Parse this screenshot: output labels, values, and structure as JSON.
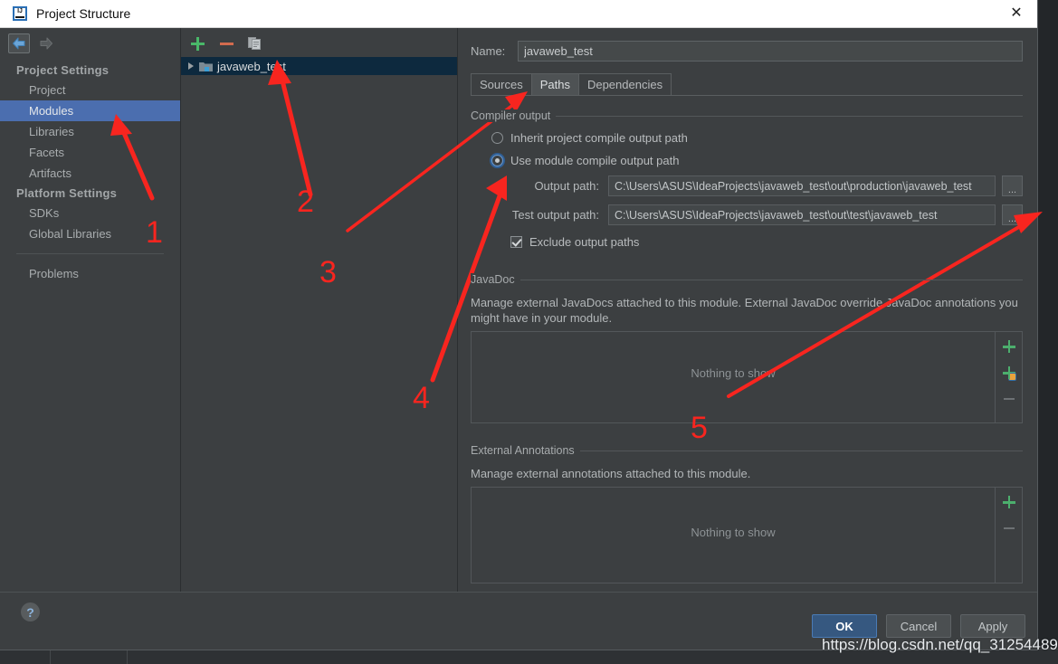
{
  "window": {
    "title": "Project Structure",
    "icon": "intellij-idea-icon",
    "close_label": "✕"
  },
  "sidebar": {
    "nav": {
      "back_icon": "arrow-left-icon",
      "forward_icon": "arrow-right-icon"
    },
    "groups": [
      {
        "label": "Project Settings",
        "items": [
          {
            "label": "Project",
            "selected": false
          },
          {
            "label": "Modules",
            "selected": true
          },
          {
            "label": "Libraries",
            "selected": false
          },
          {
            "label": "Facets",
            "selected": false
          },
          {
            "label": "Artifacts",
            "selected": false
          }
        ]
      },
      {
        "label": "Platform Settings",
        "items": [
          {
            "label": "SDKs",
            "selected": false
          },
          {
            "label": "Global Libraries",
            "selected": false
          }
        ]
      }
    ],
    "problems_label": "Problems"
  },
  "modules_panel": {
    "toolbar": {
      "add_label": "+",
      "remove_label": "−",
      "copy_icon": "copy-icon"
    },
    "items": [
      {
        "label": "javaweb_test",
        "selected": true,
        "expander": "triangle-right-icon",
        "icon": "module-folder-icon"
      }
    ]
  },
  "details": {
    "name_label": "Name:",
    "name_value": "javaweb_test",
    "tabs": [
      {
        "label": "Sources",
        "active": false
      },
      {
        "label": "Paths",
        "active": true
      },
      {
        "label": "Dependencies",
        "active": false
      }
    ],
    "compiler_output": {
      "legend": "Compiler output",
      "radio_inherit": "Inherit project compile output path",
      "radio_module": "Use module compile output path",
      "radio_selected": "module",
      "output_path_label": "Output path:",
      "output_path_value": "C:\\Users\\ASUS\\IdeaProjects\\javaweb_test\\out\\production\\javaweb_test",
      "test_output_path_label": "Test output path:",
      "test_output_path_value": "C:\\Users\\ASUS\\IdeaProjects\\javaweb_test\\out\\test\\javaweb_test",
      "browse_label": "...",
      "exclude_label": "Exclude output paths",
      "exclude_checked": true
    },
    "javadoc": {
      "legend": "JavaDoc",
      "description": "Manage external JavaDocs attached to this module. External JavaDoc override JavaDoc annotations you might have in your module.",
      "empty_text": "Nothing to show",
      "buttons": [
        {
          "name": "add-javadoc-path-button",
          "icon": "plus-icon",
          "enabled": true
        },
        {
          "name": "add-javadoc-url-button",
          "icon": "plus-globe-icon",
          "enabled": true
        },
        {
          "name": "remove-javadoc-button",
          "icon": "minus-icon",
          "enabled": false
        }
      ]
    },
    "annotations": {
      "legend": "External Annotations",
      "description": "Manage external annotations attached to this module.",
      "empty_text": "Nothing to show",
      "buttons": [
        {
          "name": "add-annotation-button",
          "icon": "plus-icon",
          "enabled": true
        },
        {
          "name": "remove-annotation-button",
          "icon": "minus-icon",
          "enabled": false
        }
      ]
    }
  },
  "footer": {
    "help_label": "?",
    "ok_label": "OK",
    "cancel_label": "Cancel",
    "apply_label": "Apply"
  },
  "annotations_overlay": {
    "color": "#f8251f",
    "numbers": [
      "1",
      "2",
      "3",
      "4",
      "5"
    ],
    "watermark": "https://blog.csdn.net/qq_31254489"
  },
  "colors": {
    "dialog_bg": "#3c3f41",
    "selection_blue": "#4b6eaf",
    "tree_selection": "#0d293e",
    "accent_green": "#4caf6d",
    "primary_button": "#365880",
    "annotation_red": "#f8251f"
  }
}
